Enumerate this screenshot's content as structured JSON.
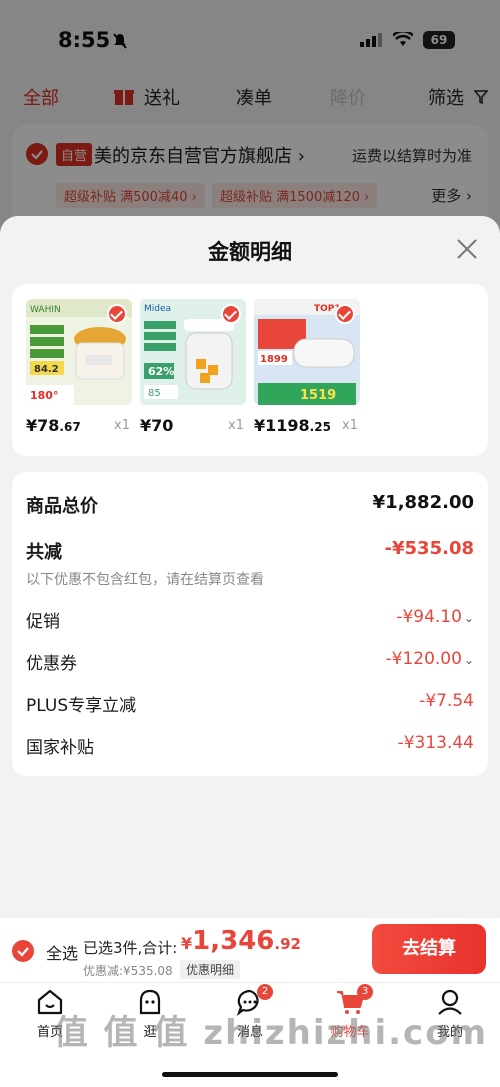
{
  "status_bar": {
    "time": "8:55",
    "battery": "69"
  },
  "filters": [
    {
      "label": "全部",
      "state": "active"
    },
    {
      "label": "送礼",
      "state": "normal"
    },
    {
      "label": "凑单",
      "state": "normal"
    },
    {
      "label": "降价",
      "state": "disabled"
    },
    {
      "label": "筛选",
      "state": "normal"
    }
  ],
  "store": {
    "tag": "自营",
    "name": "美的京东自营官方旗舰店",
    "chevron": "›",
    "freight": "运费以结算时为准",
    "promos": [
      "超级补贴 满500减40 ›",
      "超级补贴 满1500减120 ›"
    ],
    "more": "更多 ›"
  },
  "sheet": {
    "title": "金额明细",
    "items": [
      {
        "price_int": "¥78",
        "price_dec": ".67",
        "qty": "x1",
        "image_label": "WAHIN",
        "image_badge": "84.2",
        "image_bottom": "180°"
      },
      {
        "price_int": "¥70",
        "price_dec": "",
        "qty": "x1",
        "image_label": "Midea",
        "image_badge": "62%",
        "image_bottom": "85"
      },
      {
        "price_int": "¥1198",
        "price_dec": ".25",
        "qty": "x1",
        "image_label": "TOP1",
        "image_badge": "1899",
        "image_bottom": "1519"
      }
    ],
    "summary": {
      "total_label": "商品总价",
      "total_value": "¥1,882.00",
      "reduce_label": "共减",
      "reduce_value": "-¥535.08",
      "note": "以下优惠不包含红包，请在结算页查看",
      "rows": [
        {
          "label": "促销",
          "value": "-¥94.10",
          "expand": "⌄"
        },
        {
          "label": "优惠券",
          "value": "-¥120.00",
          "expand": "⌄"
        },
        {
          "label": "PLUS专享立减",
          "value": "-¥7.54",
          "expand": ""
        },
        {
          "label": "国家补贴",
          "value": "-¥313.44",
          "expand": ""
        }
      ]
    }
  },
  "checkout": {
    "select_all": "全选",
    "selected_text": "已选3件,合计:",
    "amount_yen": "¥",
    "amount_int": "1,346",
    "amount_dec": ".92",
    "discount_text": "优惠减:¥535.08",
    "detail_button": "优惠明细",
    "pay_button": "去结算"
  },
  "tabbar": [
    {
      "label": "首页",
      "icon": "home-icon",
      "badge": ""
    },
    {
      "label": "逛",
      "icon": "smile-face-icon",
      "badge": ""
    },
    {
      "label": "消息",
      "icon": "message-icon",
      "badge": "2"
    },
    {
      "label": "购物车",
      "icon": "cart-icon",
      "badge": "3"
    },
    {
      "label": "我的",
      "icon": "profile-icon",
      "badge": ""
    }
  ],
  "watermark": "值 值 值 zhizhizhi.com",
  "colors": {
    "accent": "#e8463b",
    "overlay": "rgba(0,0,0,0.45)"
  }
}
